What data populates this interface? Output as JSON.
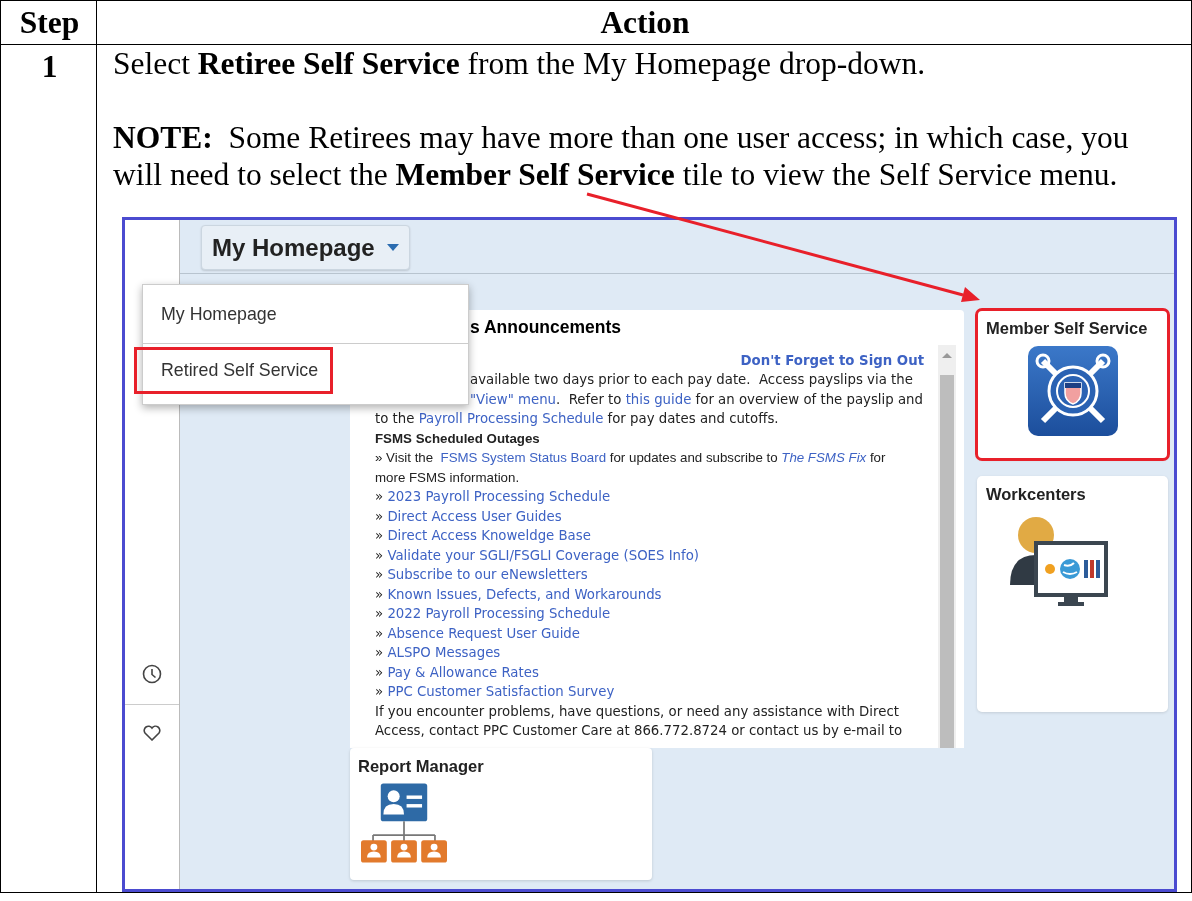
{
  "table": {
    "columns": [
      "Step",
      "Action"
    ],
    "rows": [
      {
        "step": "1",
        "instruction": "Select **Retiree Self Service** from the My Homepage drop-down.",
        "note": "**NOTE:**  Some Retirees may have more than one user access; in which case, you will need to select the **Member Self Service** tile to view the Self Service menu.",
        "screenshot": {
          "homepage_button": {
            "label": "My Homepage"
          },
          "dropdown": {
            "items": [
              {
                "label": "My Homepage",
                "highlighted": false
              },
              {
                "label": "Retired Self Service",
                "highlighted": true
              }
            ]
          },
          "announcements": {
            "title": "s Announcements",
            "lines": [
              {
                "kind": "signout",
                "partly_hidden": false,
                "segments": [
                  {
                    "kind": "bold-link",
                    "text": "Don't Forget to Sign Out"
                  }
                ]
              },
              {
                "kind": "text",
                "partly_hidden": true,
                "segments": [
                  {
                    "kind": "plain",
                    "text": "available two days prior to each pay date.  Access payslips via the"
                  }
                ]
              },
              {
                "kind": "text",
                "partly_hidden": true,
                "segments": [
                  {
                    "kind": "link",
                    "text": "\"View\" menu"
                  },
                  {
                    "kind": "plain",
                    "text": ".  Refer to "
                  },
                  {
                    "kind": "link",
                    "text": "this guide"
                  },
                  {
                    "kind": "plain",
                    "text": " for an overview of the payslip and"
                  }
                ]
              },
              {
                "kind": "text",
                "partly_hidden": false,
                "segments": [
                  {
                    "kind": "plain",
                    "text": "to the "
                  },
                  {
                    "kind": "link",
                    "text": "Payroll Processing Schedule"
                  },
                  {
                    "kind": "plain",
                    "text": " for pay dates and cutoffs."
                  }
                ]
              },
              {
                "kind": "outage",
                "partly_hidden": false,
                "segments": [
                  {
                    "kind": "bold",
                    "text": "FSMS Scheduled Outages"
                  }
                ]
              },
              {
                "kind": "outage",
                "partly_hidden": false,
                "segments": [
                  {
                    "kind": "plain",
                    "text": "» Visit the  "
                  },
                  {
                    "kind": "link",
                    "text": "FSMS System Status Board"
                  },
                  {
                    "kind": "plain",
                    "text": " for updates and subscribe to "
                  },
                  {
                    "kind": "italic-link",
                    "text": "The FSMS Fix"
                  },
                  {
                    "kind": "plain",
                    "text": " for"
                  }
                ]
              },
              {
                "kind": "outage",
                "partly_hidden": false,
                "segments": [
                  {
                    "kind": "plain",
                    "text": "more FSMS information."
                  }
                ]
              },
              {
                "kind": "text",
                "partly_hidden": false,
                "segments": [
                  {
                    "kind": "plain",
                    "text": "» "
                  },
                  {
                    "kind": "link",
                    "text": "2023 Payroll Processing Schedule"
                  }
                ]
              },
              {
                "kind": "text",
                "partly_hidden": false,
                "segments": [
                  {
                    "kind": "plain",
                    "text": "» "
                  },
                  {
                    "kind": "link",
                    "text": "Direct Access User Guides"
                  }
                ]
              },
              {
                "kind": "text",
                "partly_hidden": false,
                "segments": [
                  {
                    "kind": "plain",
                    "text": "» "
                  },
                  {
                    "kind": "link",
                    "text": "Direct Access Knoweldge Base"
                  }
                ]
              },
              {
                "kind": "text",
                "partly_hidden": false,
                "segments": [
                  {
                    "kind": "plain",
                    "text": "» "
                  },
                  {
                    "kind": "link",
                    "text": "Validate your SGLI/FSGLI Coverage (SOES Info)"
                  }
                ]
              },
              {
                "kind": "text",
                "partly_hidden": false,
                "segments": [
                  {
                    "kind": "plain",
                    "text": "» "
                  },
                  {
                    "kind": "link",
                    "text": "Subscribe to our eNewsletters"
                  }
                ]
              },
              {
                "kind": "text",
                "partly_hidden": false,
                "segments": [
                  {
                    "kind": "plain",
                    "text": "» "
                  },
                  {
                    "kind": "link",
                    "text": "Known Issues, Defects, and Workarounds"
                  }
                ]
              },
              {
                "kind": "text",
                "partly_hidden": false,
                "segments": [
                  {
                    "kind": "plain",
                    "text": "» "
                  },
                  {
                    "kind": "link",
                    "text": "2022 Payroll Processing Schedule"
                  }
                ]
              },
              {
                "kind": "text",
                "partly_hidden": false,
                "segments": [
                  {
                    "kind": "plain",
                    "text": "» "
                  },
                  {
                    "kind": "link",
                    "text": "Absence Request User Guide"
                  }
                ]
              },
              {
                "kind": "text",
                "partly_hidden": false,
                "segments": [
                  {
                    "kind": "plain",
                    "text": "» "
                  },
                  {
                    "kind": "link",
                    "text": "ALSPO Messages"
                  }
                ]
              },
              {
                "kind": "text",
                "partly_hidden": false,
                "segments": [
                  {
                    "kind": "plain",
                    "text": "» "
                  },
                  {
                    "kind": "link",
                    "text": "Pay & Allowance Rates"
                  }
                ]
              },
              {
                "kind": "text",
                "partly_hidden": false,
                "segments": [
                  {
                    "kind": "plain",
                    "text": "» "
                  },
                  {
                    "kind": "link",
                    "text": "PPC Customer Satisfaction Survey"
                  }
                ]
              },
              {
                "kind": "text",
                "partly_hidden": false,
                "segments": [
                  {
                    "kind": "plain",
                    "text": "If you encounter problems, have questions, or need any assistance with Direct"
                  }
                ]
              },
              {
                "kind": "text",
                "partly_hidden": false,
                "segments": [
                  {
                    "kind": "plain",
                    "text": "Access, contact PPC Customer Care at 866.772.8724 or contact us by e-mail to"
                  }
                ]
              }
            ]
          },
          "tiles": [
            {
              "title": "Member Self Service",
              "kind": "emblem",
              "highlighted": true
            },
            {
              "title": "Workcenters",
              "kind": "workcenter",
              "highlighted": false
            }
          ],
          "report_tile": {
            "title": "Report Manager",
            "kind": "report"
          }
        }
      }
    ]
  }
}
